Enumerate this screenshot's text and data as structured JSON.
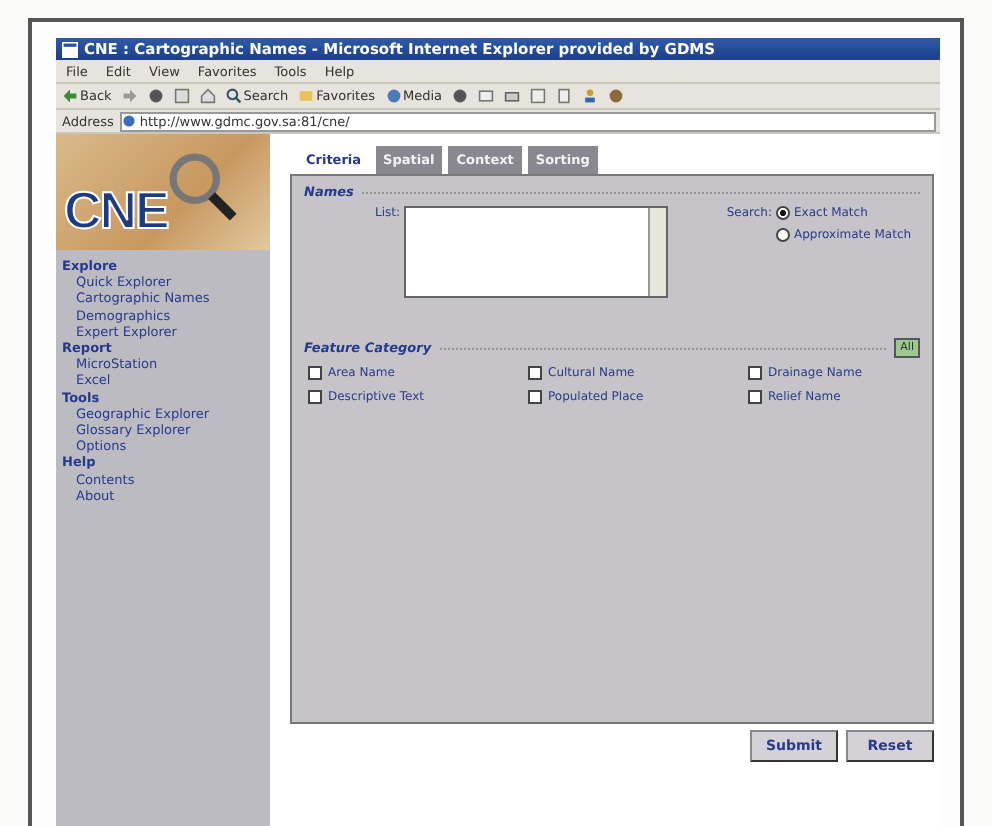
{
  "window": {
    "title": "CNE : Cartographic Names - Microsoft Internet Explorer provided by GDMS"
  },
  "menu": [
    "File",
    "Edit",
    "View",
    "Favorites",
    "Tools",
    "Help"
  ],
  "toolbar": [
    {
      "kind": "back",
      "label": "Back"
    },
    {
      "kind": "search",
      "label": "Search"
    },
    {
      "kind": "favorites",
      "label": "Favorites"
    },
    {
      "kind": "media",
      "label": "Media"
    }
  ],
  "address": {
    "label": "Address",
    "url": "http://www.gdmc.gov.sa:81/cne/"
  },
  "logo": {
    "text": "CNE"
  },
  "sidebar": [
    {
      "label": "Explore",
      "children": [
        "Quick Explorer",
        "Cartographic Names",
        "Demographics",
        "Expert Explorer"
      ]
    },
    {
      "label": "Report",
      "children": [
        "MicroStation",
        "Excel"
      ]
    },
    {
      "label": "Tools",
      "children": [
        "Geographic Explorer",
        "Glossary Explorer",
        "Options"
      ]
    },
    {
      "label": "Help",
      "children": [
        "Contents",
        "About"
      ]
    }
  ],
  "tabs": [
    {
      "label": "Criteria",
      "selected": true
    },
    {
      "label": "Spatial",
      "selected": false
    },
    {
      "label": "Context",
      "selected": false
    },
    {
      "label": "Sorting",
      "selected": false
    }
  ],
  "names": {
    "title": "Names",
    "list_label": "List:",
    "search_label": "Search:",
    "options": [
      {
        "label": "Exact Match",
        "selected": true
      },
      {
        "label": "Approximate Match",
        "selected": false
      }
    ]
  },
  "feature_category": {
    "title": "Feature Category",
    "all_button": "All",
    "items": [
      {
        "label": "Area Name",
        "checked": false
      },
      {
        "label": "Cultural Name",
        "checked": false
      },
      {
        "label": "Drainage Name",
        "checked": false
      },
      {
        "label": "Descriptive Text",
        "checked": false
      },
      {
        "label": "Populated Place",
        "checked": false
      },
      {
        "label": "Relief Name",
        "checked": false
      }
    ]
  },
  "buttons": [
    "Submit",
    "Reset"
  ]
}
